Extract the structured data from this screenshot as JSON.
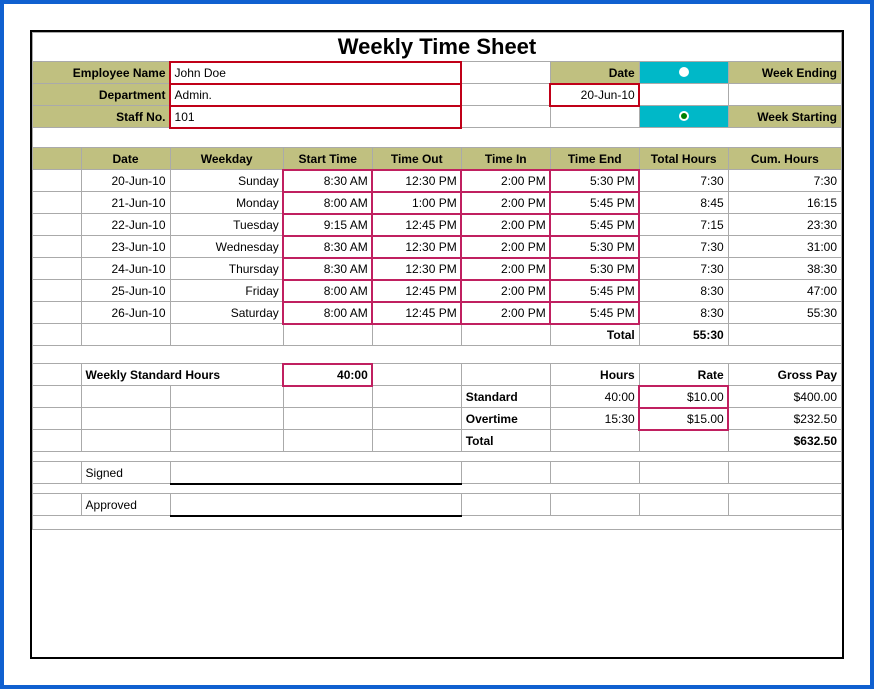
{
  "title": "Weekly Time Sheet",
  "labels": {
    "employee_name": "Employee Name",
    "department": "Department",
    "staff_no": "Staff No.",
    "date": "Date",
    "week_ending": "Week Ending",
    "week_starting": "Week Starting",
    "weekly_std_hours": "Weekly Standard Hours",
    "hours": "Hours",
    "rate": "Rate",
    "gross_pay": "Gross Pay",
    "standard": "Standard",
    "overtime": "Overtime",
    "total": "Total",
    "signed": "Signed",
    "approved": "Approved"
  },
  "employee": {
    "name": "John Doe",
    "department": "Admin.",
    "staff_no": "101",
    "date": "20-Jun-10"
  },
  "columns": {
    "date": "Date",
    "weekday": "Weekday",
    "start": "Start Time",
    "out": "Time Out",
    "in": "Time In",
    "end": "Time End",
    "total": "Total Hours",
    "cum": "Cum. Hours"
  },
  "rows": [
    {
      "date": "20-Jun-10",
      "weekday": "Sunday",
      "start": "8:30 AM",
      "out": "12:30 PM",
      "in": "2:00 PM",
      "end": "5:30 PM",
      "total": "7:30",
      "cum": "7:30"
    },
    {
      "date": "21-Jun-10",
      "weekday": "Monday",
      "start": "8:00 AM",
      "out": "1:00 PM",
      "in": "2:00 PM",
      "end": "5:45 PM",
      "total": "8:45",
      "cum": "16:15"
    },
    {
      "date": "22-Jun-10",
      "weekday": "Tuesday",
      "start": "9:15 AM",
      "out": "12:45 PM",
      "in": "2:00 PM",
      "end": "5:45 PM",
      "total": "7:15",
      "cum": "23:30"
    },
    {
      "date": "23-Jun-10",
      "weekday": "Wednesday",
      "start": "8:30 AM",
      "out": "12:30 PM",
      "in": "2:00 PM",
      "end": "5:30 PM",
      "total": "7:30",
      "cum": "31:00"
    },
    {
      "date": "24-Jun-10",
      "weekday": "Thursday",
      "start": "8:30 AM",
      "out": "12:30 PM",
      "in": "2:00 PM",
      "end": "5:30 PM",
      "total": "7:30",
      "cum": "38:30"
    },
    {
      "date": "25-Jun-10",
      "weekday": "Friday",
      "start": "8:00 AM",
      "out": "12:45 PM",
      "in": "2:00 PM",
      "end": "5:45 PM",
      "total": "8:30",
      "cum": "47:00"
    },
    {
      "date": "26-Jun-10",
      "weekday": "Saturday",
      "start": "8:00 AM",
      "out": "12:45 PM",
      "in": "2:00 PM",
      "end": "5:45 PM",
      "total": "8:30",
      "cum": "55:30"
    }
  ],
  "totals": {
    "grand_total_hours": "55:30",
    "weekly_std_hours": "40:00",
    "standard": {
      "hours": "40:00",
      "rate": "$10.00",
      "pay": "$400.00"
    },
    "overtime": {
      "hours": "15:30",
      "rate": "$15.00",
      "pay": "$232.50"
    },
    "gross_total": "$632.50"
  }
}
